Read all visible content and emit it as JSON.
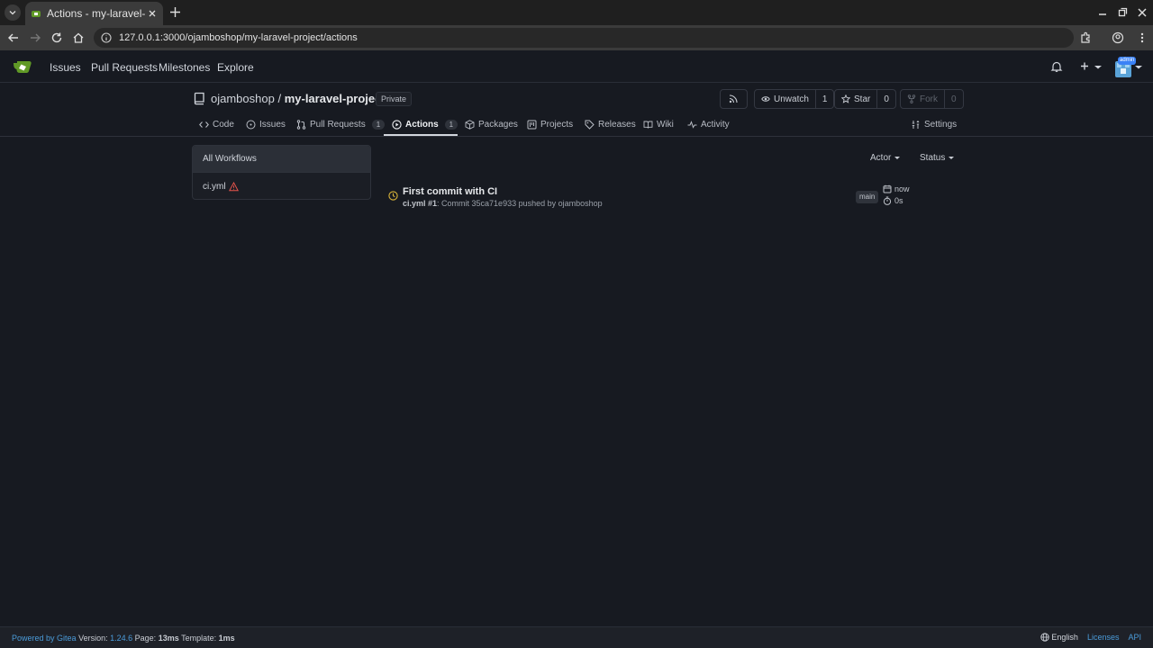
{
  "browser": {
    "tab_title": "Actions - my-laravel-project",
    "url": "127.0.0.1:3000/ojamboshop/my-laravel-project/actions"
  },
  "navbar": {
    "links": [
      "Issues",
      "Pull Requests",
      "Milestones",
      "Explore"
    ],
    "admin_badge": "admin"
  },
  "repo": {
    "owner": "ojamboshop",
    "separator": "/",
    "name": "my-laravel-project",
    "visibility": "Private",
    "unwatch_label": "Unwatch",
    "watch_count": "1",
    "star_label": "Star",
    "star_count": "0",
    "fork_label": "Fork",
    "fork_count": "0"
  },
  "tabs": {
    "code": "Code",
    "issues": "Issues",
    "pulls": "Pull Requests",
    "pulls_count": "1",
    "actions": "Actions",
    "actions_count": "1",
    "packages": "Packages",
    "projects": "Projects",
    "releases": "Releases",
    "wiki": "Wiki",
    "activity": "Activity",
    "settings": "Settings"
  },
  "workflows": {
    "all": "All Workflows",
    "items": [
      {
        "name": "ci.yml",
        "status": "warning"
      }
    ]
  },
  "filters": {
    "actor": "Actor",
    "status": "Status"
  },
  "runs": [
    {
      "title": "First commit with CI",
      "workflow": "ci.yml #1",
      "detail": ": Commit 35ca71e933 pushed by ojamboshop",
      "branch": "main",
      "when": "now",
      "duration": "0s",
      "status": "waiting",
      "status_color": "#d9b43a"
    }
  ],
  "footer": {
    "powered": "Powered by Gitea",
    "version_label": "Version:",
    "version": "1.24.6",
    "page_label": "Page:",
    "page_time": "13ms",
    "template_label": "Template:",
    "template_time": "1ms",
    "language": "English",
    "licenses": "Licenses",
    "api": "API"
  },
  "colors": {
    "background": "#171a21",
    "link": "#4a9bd9",
    "warning": "#e5534b",
    "waiting": "#d9b43a"
  }
}
